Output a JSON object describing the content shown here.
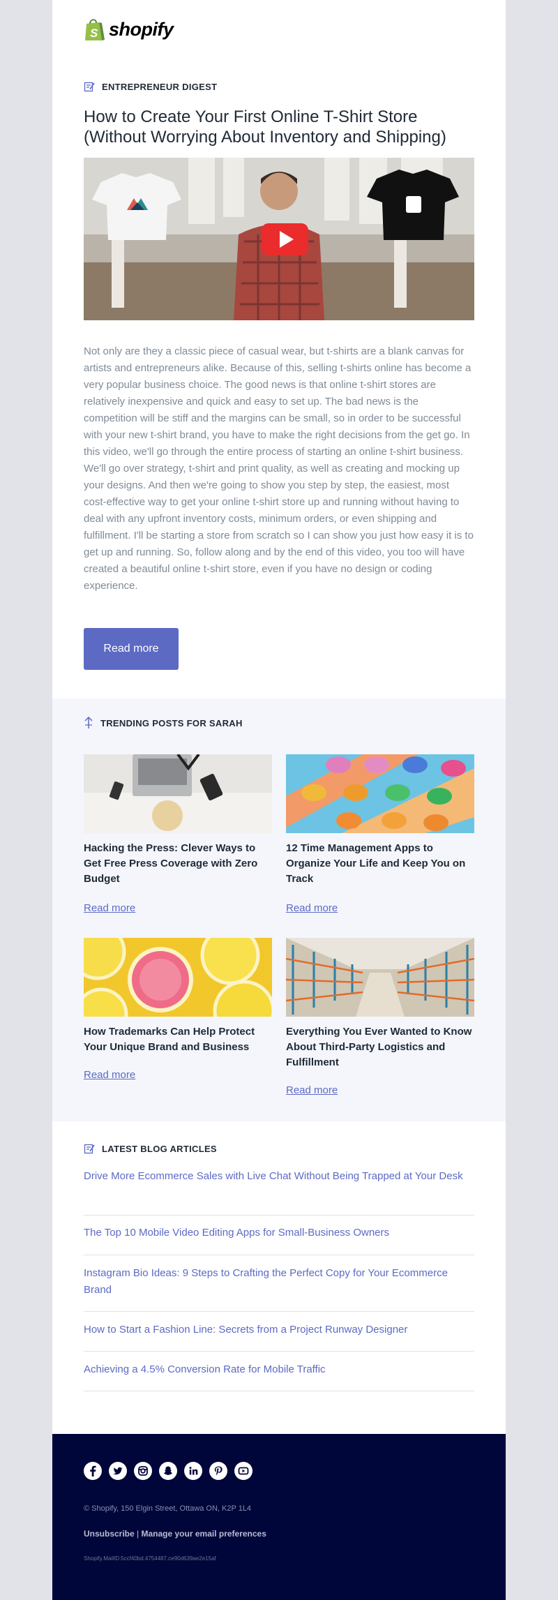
{
  "brand": {
    "name": "shopify",
    "accent": "#5c6ac4",
    "logo_green": "#95bf47",
    "footer_bg": "#000639"
  },
  "digest": {
    "kicker": "ENTREPRENEUR DIGEST",
    "title": "How to Create Your First Online T-Shirt Store (Without Worrying About Inventory and Shipping)",
    "video": {
      "icon": "play-button-icon"
    },
    "body": "Not only are they a classic piece of casual wear, but t-shirts are a blank canvas for artists and entrepreneurs alike. Because of this, selling t-shirts online has become a very popular business choice. The good news is that online t-shirt stores are relatively inexpensive and quick and easy to set up. The bad news is the competition will be stiff and the margins can be small, so in order to be successful with your new t-shirt brand, you have to make the right decisions from the get go. In this video, we'll go through the entire process of starting an online t-shirt business. We'll go over strategy, t-shirt and print quality, as well as creating and mocking up your designs. And then we're going to show you step by step, the easiest, most cost-effective way to get your online t-shirt store up and running without having to deal with any upfront inventory costs, minimum orders, or even shipping and fulfillment. I'll be starting a store from scratch so I can show you just how easy it is to get up and running. So, follow along and by the end of this video, you too will have created a beautiful online t-shirt store, even if you have no design or coding experience.",
    "button": "Read more"
  },
  "trending": {
    "kicker": "TRENDING POSTS FOR SARAH",
    "posts": [
      {
        "title": "Hacking the Press: Clever Ways to Get Free Press Coverage with Zero Budget",
        "link": "Read more"
      },
      {
        "title": "12 Time Management Apps to Organize Your Life and Keep You on Track",
        "link": "Read more"
      },
      {
        "title": "How Trademarks Can Help Protect Your Unique Brand and Business",
        "link": "Read more"
      },
      {
        "title": "Everything You Ever Wanted to Know About Third-Party Logistics and Fulfillment",
        "link": "Read more"
      }
    ]
  },
  "latest": {
    "kicker": "LATEST BLOG ARTICLES",
    "posts": [
      "Drive More Ecommerce Sales with Live Chat Without Being Trapped at Your Desk",
      "The Top 10 Mobile Video Editing Apps for Small-Business Owners",
      "Instagram Bio Ideas: 9 Steps to Crafting the Perfect Copy for Your Ecommerce Brand",
      "How to Start a Fashion Line: Secrets from a Project Runway Designer",
      "Achieving a 4.5% Conversion Rate for Mobile Traffic"
    ]
  },
  "footer": {
    "social": [
      "facebook-icon",
      "twitter-icon",
      "instagram-icon",
      "snapchat-icon",
      "linkedin-icon",
      "pinterest-icon",
      "youtube-icon"
    ],
    "address": "© Shopify,  150 Elgin Street, Ottawa ON, K2P 1L4",
    "unsubscribe": "Unsubscribe",
    "separator": "|",
    "preferences": "Manage your email preferences",
    "mail_id": "Shopify.MailID:5ccf40bd.4754487.ce90d639ae2e15af"
  }
}
